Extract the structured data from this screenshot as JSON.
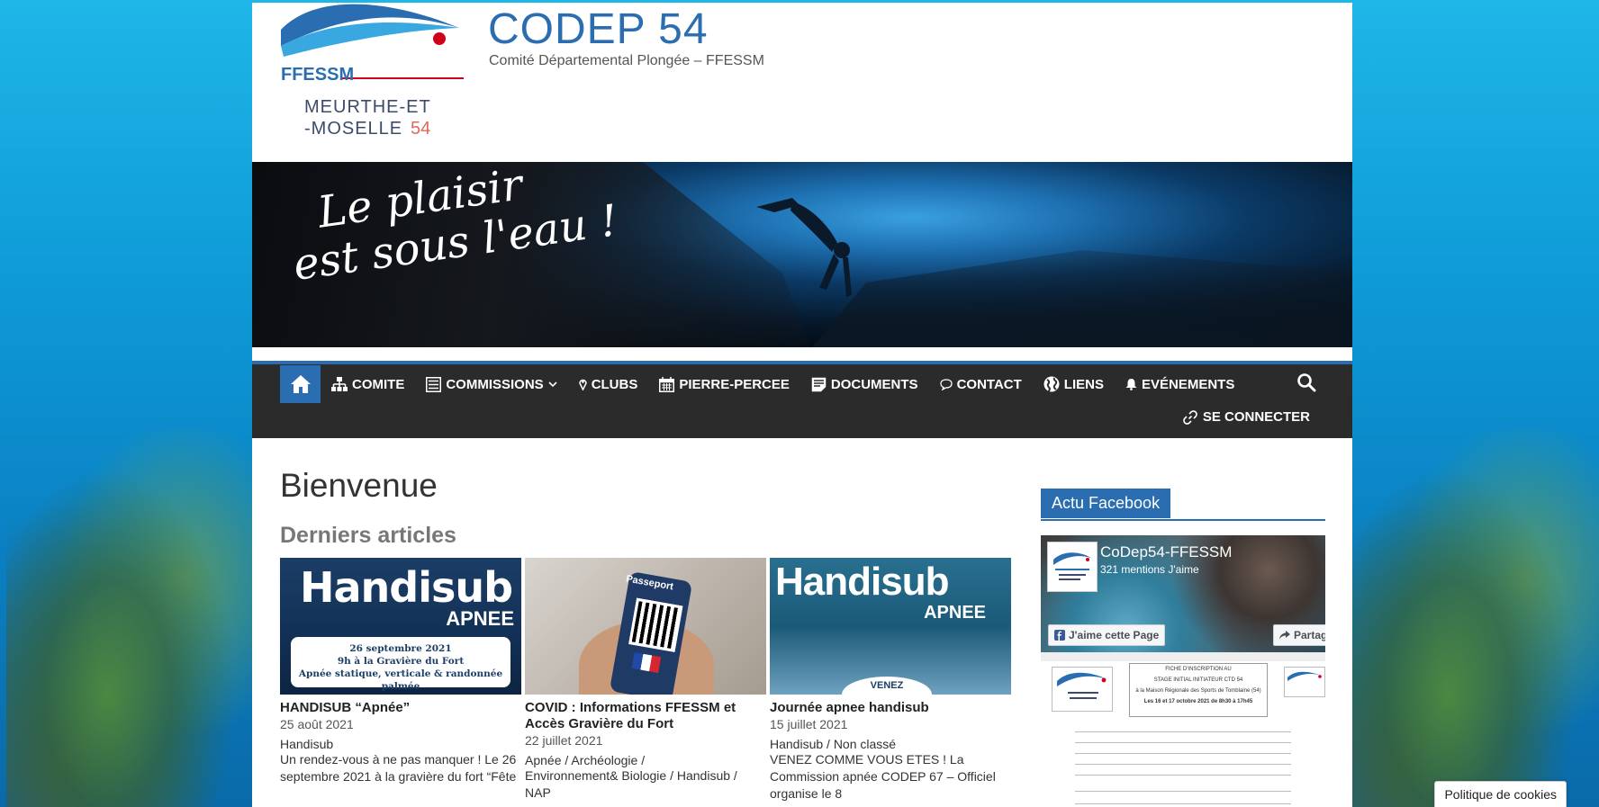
{
  "site": {
    "title": "CODEP 54",
    "description": "Comité Départemental Plongée – FFESSM",
    "logo_text_line1": "FFESSM",
    "logo_text_line2": "MEURTHE-ET",
    "logo_text_line3": "-MOSELLE",
    "logo_text_num": "54"
  },
  "banner": {
    "line1": "Le plaisir",
    "line2": "est sous l'eau !"
  },
  "nav": {
    "items": [
      {
        "label": "COMITE",
        "icon": "sitemap-icon"
      },
      {
        "label": "COMMISSIONS",
        "icon": "list-icon",
        "has_dropdown": true
      },
      {
        "label": "CLUBS",
        "icon": "map-pin-icon"
      },
      {
        "label": "PIERRE-PERCEE",
        "icon": "calendar-icon"
      },
      {
        "label": "DOCUMENTS",
        "icon": "document-icon"
      },
      {
        "label": "CONTACT",
        "icon": "speech-bubble-icon"
      },
      {
        "label": "LIENS",
        "icon": "globe-icon"
      },
      {
        "label": "EVÉNEMENTS",
        "icon": "bell-icon"
      }
    ],
    "login_label": "SE CONNECTER"
  },
  "main": {
    "page_title": "Bienvenue",
    "section_title": "Derniers articles",
    "posts": [
      {
        "title": "HANDISUB “Apnée”",
        "date": "25 août 2021",
        "categories": "Handisub",
        "excerpt": "Un rendez-vous à ne pas manquer ! Le 26 septembre 2021 à la gravière du fort “Fête",
        "thumb_title": "Handisub",
        "thumb_sub": "APNEE",
        "thumb_card": [
          "26 septembre 2021",
          "9h à la Gravière du Fort",
          "Apnée statique, verticale & randonnée palmée"
        ]
      },
      {
        "title": "COVID : Informations FFESSM et Accès Gravière du Fort",
        "date": "22 juillet 2021",
        "categories": "Apnée / Archéologie /",
        "excerpt": "Environnement& Biologie / Handisub / NAP",
        "thumb_label": "Passeport"
      },
      {
        "title": "Journée apnee handisub",
        "date": "15 juillet 2021",
        "categories": "Handisub / Non classé",
        "excerpt": "VENEZ COMME VOUS ETES ! La Commission apnée CODEP 67 – Officiel organise le 8",
        "thumb_title": "Handisub",
        "thumb_sub": "APNEE",
        "thumb_bottom": "VENEZ"
      }
    ]
  },
  "sidebar": {
    "widget_title": "Actu Facebook",
    "fb": {
      "page_name": "CoDep54-FFESSM",
      "likes": "321 mentions J'aime",
      "like_button": "J'aime cette Page",
      "share_button": "Partag",
      "fiche_title1": "FICHE D'INSCRIPTION AU",
      "fiche_title2": "STAGE INITIAL INITIATEUR CTD 54",
      "fiche_title3": "à la Maison Régionale des Sports de Tomblaine (54)",
      "fiche_title4": "Les 16 et 17 octobre 2021   de 8h30 à 17h45"
    }
  },
  "cookie": {
    "label": "Politique de cookies"
  },
  "colors": {
    "accent": "#2a6db0",
    "nav_bg": "#2b2b2b"
  }
}
